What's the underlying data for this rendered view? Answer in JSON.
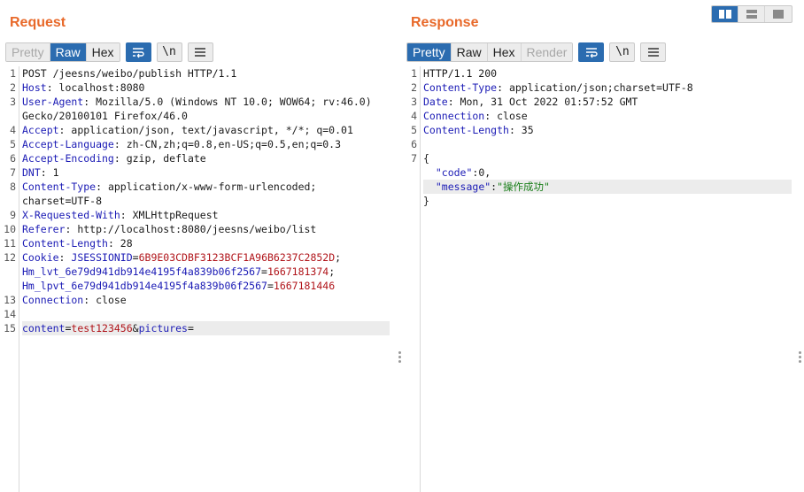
{
  "request": {
    "title": "Request",
    "view_tabs": [
      {
        "label": "Pretty",
        "state": "disabled"
      },
      {
        "label": "Raw",
        "state": "active"
      },
      {
        "label": "Hex",
        "state": "normal"
      }
    ],
    "newline_label": "\\n",
    "lines": [
      {
        "num": "1",
        "parts": [
          {
            "t": "POST /jeesns/weibo/publish HTTP/1.1",
            "c": "v"
          }
        ]
      },
      {
        "num": "2",
        "parts": [
          {
            "t": "Host",
            "c": "k"
          },
          {
            "t": ": localhost:8080",
            "c": "v"
          }
        ]
      },
      {
        "num": "3",
        "parts": [
          {
            "t": "User-Agent",
            "c": "k"
          },
          {
            "t": ": Mozilla/5.0 (Windows NT 10.0; WOW64; rv:46.0)",
            "c": "v"
          }
        ]
      },
      {
        "num": "",
        "parts": [
          {
            "t": "Gecko/20100101 Firefox/46.0",
            "c": "v"
          }
        ]
      },
      {
        "num": "4",
        "parts": [
          {
            "t": "Accept",
            "c": "k"
          },
          {
            "t": ": application/json, text/javascript, */*; q=0.01",
            "c": "v"
          }
        ]
      },
      {
        "num": "5",
        "parts": [
          {
            "t": "Accept-Language",
            "c": "k"
          },
          {
            "t": ": zh-CN,zh;q=0.8,en-US;q=0.5,en;q=0.3",
            "c": "v"
          }
        ]
      },
      {
        "num": "6",
        "parts": [
          {
            "t": "Accept-Encoding",
            "c": "k"
          },
          {
            "t": ": gzip, deflate",
            "c": "v"
          }
        ]
      },
      {
        "num": "7",
        "parts": [
          {
            "t": "DNT",
            "c": "k"
          },
          {
            "t": ": 1",
            "c": "v"
          }
        ]
      },
      {
        "num": "8",
        "parts": [
          {
            "t": "Content-Type",
            "c": "k"
          },
          {
            "t": ": application/x-www-form-urlencoded;",
            "c": "v"
          }
        ]
      },
      {
        "num": "",
        "parts": [
          {
            "t": "charset=UTF-8",
            "c": "v"
          }
        ]
      },
      {
        "num": "9",
        "parts": [
          {
            "t": "X-Requested-With",
            "c": "k"
          },
          {
            "t": ": XMLHttpRequest",
            "c": "v"
          }
        ]
      },
      {
        "num": "10",
        "parts": [
          {
            "t": "Referer",
            "c": "k"
          },
          {
            "t": ": http://localhost:8080/jeesns/weibo/list",
            "c": "v"
          }
        ]
      },
      {
        "num": "11",
        "parts": [
          {
            "t": "Content-Length",
            "c": "k"
          },
          {
            "t": ": 28",
            "c": "v"
          }
        ]
      },
      {
        "num": "12",
        "parts": [
          {
            "t": "Cookie",
            "c": "k"
          },
          {
            "t": ": ",
            "c": "v"
          },
          {
            "t": "JSESSIONID",
            "c": "k"
          },
          {
            "t": "=",
            "c": "v"
          },
          {
            "t": "6B9E03CDBF3123BCF1A96B6237C2852D",
            "c": "red"
          },
          {
            "t": ";",
            "c": "v"
          }
        ]
      },
      {
        "num": "",
        "parts": [
          {
            "t": "Hm_lvt_6e79d941db914e4195f4a839b06f2567",
            "c": "k"
          },
          {
            "t": "=",
            "c": "v"
          },
          {
            "t": "1667181374",
            "c": "red"
          },
          {
            "t": ";",
            "c": "v"
          }
        ]
      },
      {
        "num": "",
        "parts": [
          {
            "t": "Hm_lpvt_6e79d941db914e4195f4a839b06f2567",
            "c": "k"
          },
          {
            "t": "=",
            "c": "v"
          },
          {
            "t": "1667181446",
            "c": "red"
          }
        ]
      },
      {
        "num": "13",
        "parts": [
          {
            "t": "Connection",
            "c": "k"
          },
          {
            "t": ": close",
            "c": "v"
          }
        ]
      },
      {
        "num": "14",
        "parts": []
      },
      {
        "num": "15",
        "hl": true,
        "parts": [
          {
            "t": "content",
            "c": "k"
          },
          {
            "t": "=",
            "c": "v"
          },
          {
            "t": "test123456",
            "c": "red"
          },
          {
            "t": "&",
            "c": "v"
          },
          {
            "t": "pictures",
            "c": "k"
          },
          {
            "t": "=",
            "c": "v"
          }
        ]
      }
    ]
  },
  "response": {
    "title": "Response",
    "view_tabs": [
      {
        "label": "Pretty",
        "state": "active"
      },
      {
        "label": "Raw",
        "state": "normal"
      },
      {
        "label": "Hex",
        "state": "normal"
      },
      {
        "label": "Render",
        "state": "disabled"
      }
    ],
    "newline_label": "\\n",
    "lines": [
      {
        "num": "1",
        "parts": [
          {
            "t": "HTTP/1.1 200",
            "c": "v"
          }
        ]
      },
      {
        "num": "2",
        "parts": [
          {
            "t": "Content-Type",
            "c": "k"
          },
          {
            "t": ": application/json;charset=UTF-8",
            "c": "v"
          }
        ]
      },
      {
        "num": "3",
        "parts": [
          {
            "t": "Date",
            "c": "k"
          },
          {
            "t": ": Mon, 31 Oct 2022 01:57:52 GMT",
            "c": "v"
          }
        ]
      },
      {
        "num": "4",
        "parts": [
          {
            "t": "Connection",
            "c": "k"
          },
          {
            "t": ": close",
            "c": "v"
          }
        ]
      },
      {
        "num": "5",
        "parts": [
          {
            "t": "Content-Length",
            "c": "k"
          },
          {
            "t": ": 35",
            "c": "v"
          }
        ]
      },
      {
        "num": "6",
        "parts": []
      },
      {
        "num": "7",
        "parts": [
          {
            "t": "{",
            "c": "v"
          }
        ]
      },
      {
        "num": "",
        "parts": [
          {
            "t": "  ",
            "c": "v"
          },
          {
            "t": "\"code\"",
            "c": "jk"
          },
          {
            "t": ":0,",
            "c": "v"
          }
        ]
      },
      {
        "num": "",
        "hl": true,
        "parts": [
          {
            "t": "  ",
            "c": "v"
          },
          {
            "t": "\"message\"",
            "c": "jk"
          },
          {
            "t": ":",
            "c": "v"
          },
          {
            "t": "\"操作成功\"",
            "c": "js"
          }
        ]
      },
      {
        "num": "",
        "parts": [
          {
            "t": "}",
            "c": "v"
          }
        ]
      }
    ]
  },
  "icons": {
    "wrap": "wrap-lines-icon",
    "menu": "hamburger-menu-icon",
    "layout": [
      "split-horizontal-icon",
      "split-vertical-icon",
      "single-pane-icon"
    ]
  }
}
